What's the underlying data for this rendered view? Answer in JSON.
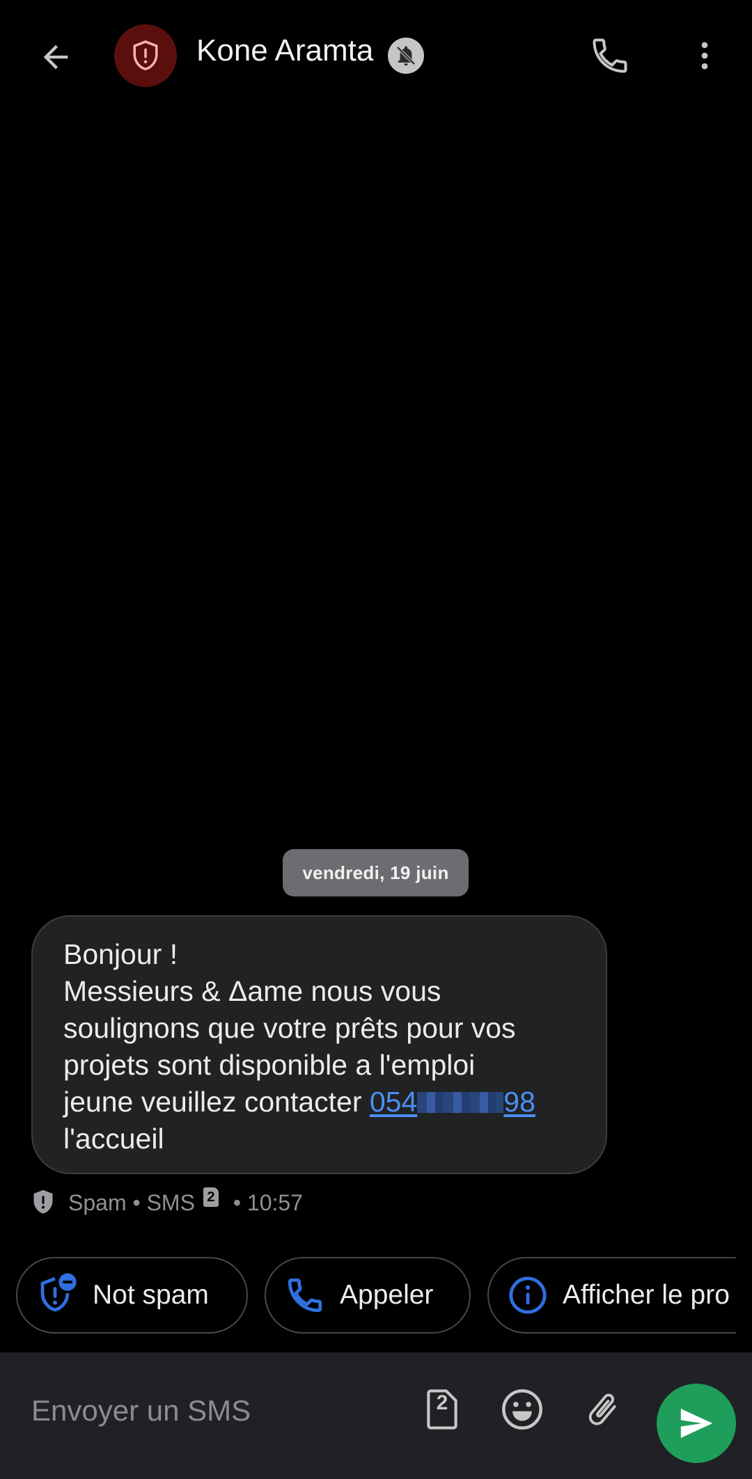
{
  "header": {
    "contact_name": "Kone Aramta",
    "icons": {
      "back": "arrow-back-icon",
      "avatar": "spam-shield-icon",
      "muted": "bell-off-icon",
      "call": "phone-icon",
      "more": "more-vert-icon"
    }
  },
  "conversation": {
    "date_divider": "vendredi, 19 juin",
    "message": {
      "line1": "Bonjour !",
      "line2": "Messieurs & Δame nous vous",
      "line3": "soulignons que votre prêts pour vos",
      "line4": "projets sont disponible a l'emploi",
      "line5_prefix": "jeune veuillez contacter ",
      "phone_start": "054",
      "phone_end": "98",
      "line6": "l'accueil"
    },
    "meta": {
      "status": "Spam",
      "separator1": " • ",
      "channel": "SMS",
      "sim_number": "2",
      "separator2": " • ",
      "time": "10:57"
    }
  },
  "suggestions": [
    {
      "label": "Not spam",
      "icon": "shield-minus-icon"
    },
    {
      "label": "Appeler",
      "icon": "phone-icon"
    },
    {
      "label": "Afficher le pro",
      "icon": "info-icon"
    }
  ],
  "compose": {
    "placeholder": "Envoyer un SMS",
    "sim_number": "2",
    "icons": [
      "sim-card-icon",
      "emoji-icon",
      "attach-icon",
      "send-icon"
    ]
  },
  "colors": {
    "background": "#000000",
    "bubble": "#212224",
    "link": "#4b8ff5",
    "accent_blue": "#2f6fe0",
    "send": "#1e9e5a",
    "avatar": "#5a0f0c"
  }
}
